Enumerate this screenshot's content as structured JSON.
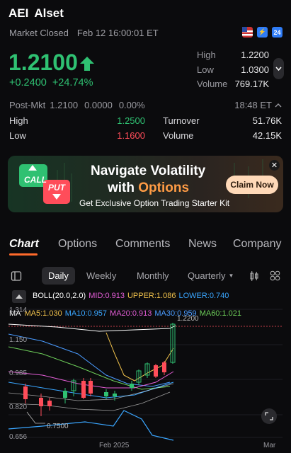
{
  "header": {
    "ticker": "AEI",
    "name": "Alset",
    "market_status": "Market Closed",
    "timestamp": "Feb 12 16:00:01 ET",
    "badge_24": "24"
  },
  "quote": {
    "price": "1.2100",
    "change": "+0.2400",
    "change_pct": "+24.74%",
    "high_label": "High",
    "high_value": "1.2200",
    "low_label": "Low",
    "low_value": "1.0300",
    "volume_label": "Volume",
    "volume_value": "769.17K"
  },
  "postmarket": {
    "label": "Post-Mkt",
    "price": "1.2100",
    "change": "0.0000",
    "change_pct": "0.00%",
    "time": "18:48 ET"
  },
  "post_stats": {
    "high_label": "High",
    "high_value": "1.2500",
    "low_label": "Low",
    "low_value": "1.1600",
    "turnover_label": "Turnover",
    "turnover_value": "51.76K",
    "volume_label": "Volume",
    "volume_value": "42.15K"
  },
  "banner": {
    "call": "CALL",
    "put": "PUT",
    "title_line1": "Navigate Volatility",
    "title_line2_prefix": "with ",
    "title_line2_highlight": "Options",
    "subtitle": "Get Exclusive Option Trading Starter Kit",
    "cta": "Claim Now"
  },
  "tabs": [
    "Chart",
    "Options",
    "Comments",
    "News",
    "Company"
  ],
  "periods": [
    "Daily",
    "Weekly",
    "Monthly",
    "Quarterly"
  ],
  "indicators": {
    "boll_label": "BOLL(20.0,2.0)",
    "boll_mid": "MID:0.913",
    "boll_upper": "UPPER:1.086",
    "boll_lower": "LOWER:0.740",
    "ma_label": "MA",
    "ma5": "MA5:1.030",
    "ma10": "MA10:0.957",
    "ma20": "MA20:0.913",
    "ma30": "MA30:0.959",
    "ma60": "MA60:1.021"
  },
  "chart_data": {
    "type": "candlestick",
    "y_ticks": [
      "1.314",
      "1.150",
      "0.985",
      "0.820",
      "0.656"
    ],
    "x_ticks": [
      "Feb 2025",
      "Mar"
    ],
    "high_annotation": "1.2200",
    "low_annotation": "0.7500",
    "colors": {
      "up": "#2fc172",
      "down": "#ff4d5a",
      "ma5": "#f0c14b",
      "ma10": "#3aa6ff",
      "ma20": "#e55ed8",
      "ma30": "#4a9bff",
      "ma60": "#6ecf5a",
      "boll": "#ffffff"
    }
  },
  "colors": {
    "accent": "#ff6a2b",
    "up": "#2fc172",
    "down": "#ff4d5a"
  }
}
